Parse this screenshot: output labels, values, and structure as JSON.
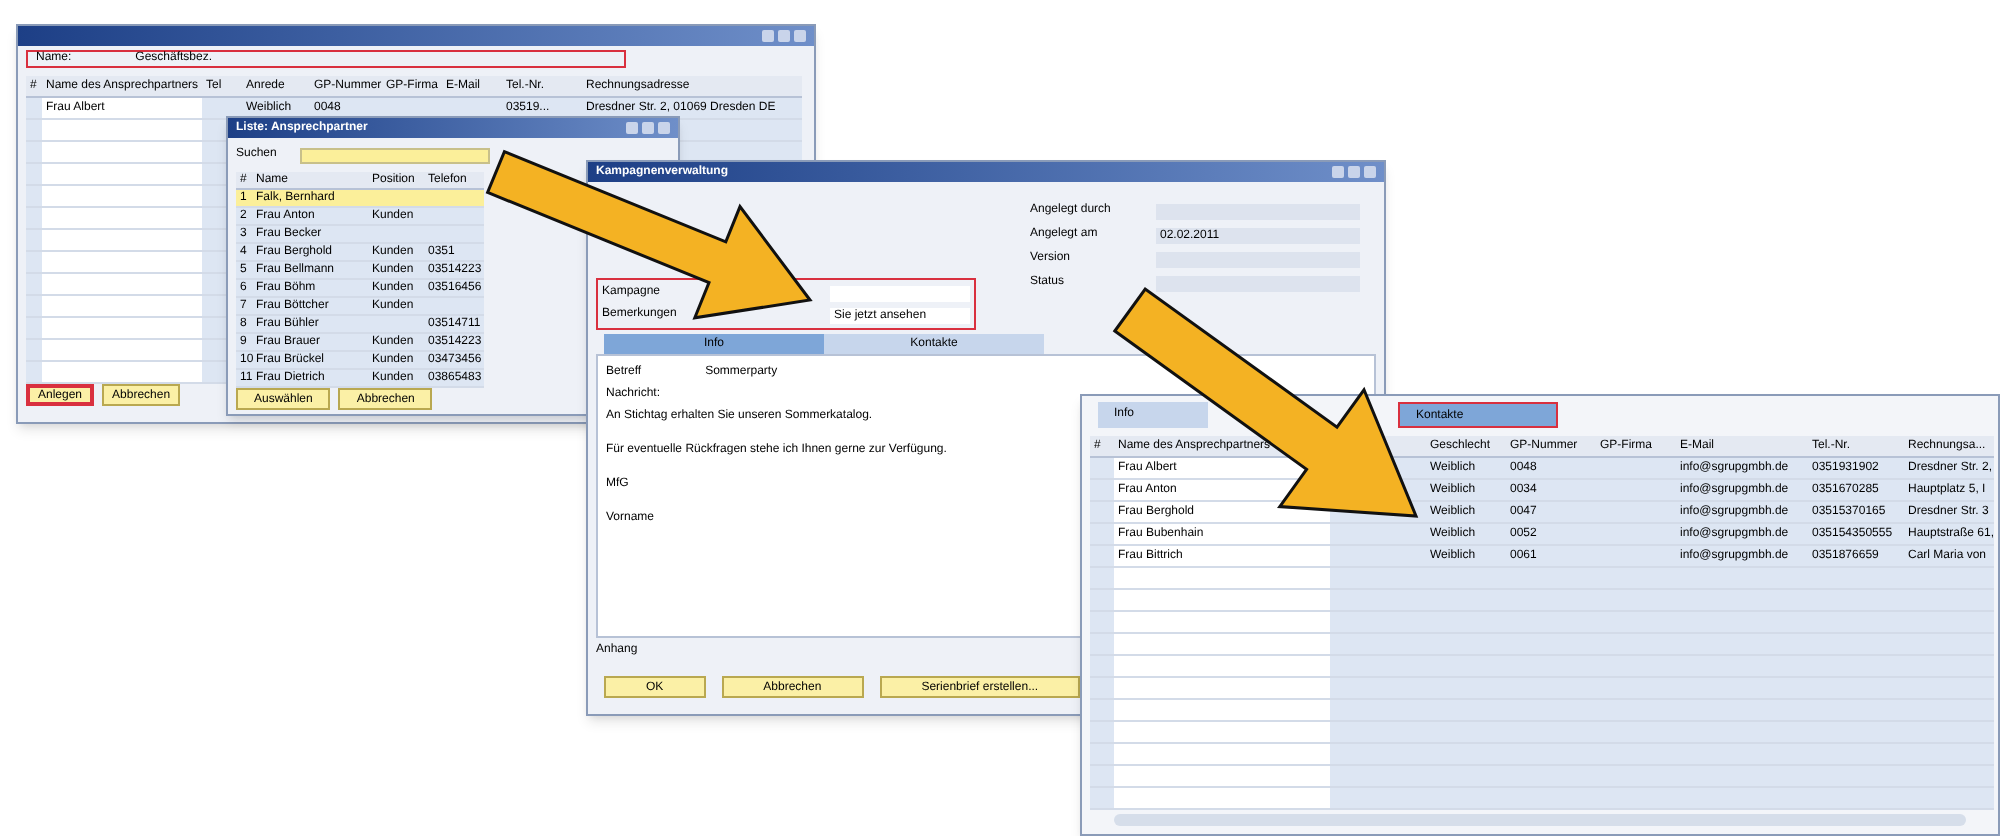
{
  "contact_window": {
    "name_label": "Name:",
    "name_value": "Geschäftsbez.",
    "columns": [
      "#",
      "Name des Ansprechpartners",
      "Tel",
      "Anrede",
      "GP-Nummer",
      "GP-Firma",
      "E-Mail",
      "Tel.-Nr.",
      "Rechnungsadresse"
    ],
    "rows": [
      {
        "cells": [
          "",
          "Frau Albert",
          "",
          "Weiblich",
          "0048",
          "",
          "",
          "03519...",
          "Dresdner Str. 2, 01069 Dresden DE"
        ]
      }
    ],
    "buttons": [
      {
        "label": "Anlegen",
        "highlighted": true
      },
      {
        "label": "Abbrechen",
        "highlighted": false
      }
    ]
  },
  "picker_window": {
    "title": "Liste: Ansprechpartner",
    "search_label": "Suchen",
    "columns": [
      "#",
      "Name",
      "Position",
      "Telefon"
    ],
    "rows": [
      {
        "cells": [
          "1",
          "Falk, Bernhard",
          "",
          ""
        ],
        "selected": true
      },
      {
        "cells": [
          "2",
          "Frau Anton",
          "Kunden",
          ""
        ],
        "selected": false
      },
      {
        "cells": [
          "3",
          "Frau Becker",
          "",
          ""
        ],
        "selected": false
      },
      {
        "cells": [
          "4",
          "Frau Berghold",
          "Kunden",
          "0351"
        ],
        "selected": false
      },
      {
        "cells": [
          "5",
          "Frau Bellmann",
          "Kunden",
          "03514223"
        ],
        "selected": false
      },
      {
        "cells": [
          "6",
          "Frau Böhm",
          "Kunden",
          "03516456"
        ],
        "selected": false
      },
      {
        "cells": [
          "7",
          "Frau Böttcher",
          "Kunden",
          ""
        ],
        "selected": false
      },
      {
        "cells": [
          "8",
          "Frau Bühler",
          "",
          "03514711"
        ],
        "selected": false
      },
      {
        "cells": [
          "9",
          "Frau Brauer",
          "Kunden",
          "03514223"
        ],
        "selected": false
      },
      {
        "cells": [
          "10",
          "Frau Brückel",
          "Kunden",
          "03473456"
        ],
        "selected": false
      },
      {
        "cells": [
          "11",
          "Frau Dietrich",
          "Kunden",
          "03865483"
        ],
        "selected": false
      }
    ],
    "buttons": [
      "Auswählen",
      "Abbrechen"
    ]
  },
  "campaign_window": {
    "title": "Kampagnenverwaltung",
    "left_fields": [
      {
        "label": "Kampagne"
      },
      {
        "label": "Bemerkungen",
        "value": "Sie jetzt ansehen"
      }
    ],
    "right_fields": [
      {
        "label": "Angelegt durch"
      },
      {
        "label": "Angelegt am",
        "value": "02.02.2011"
      },
      {
        "label": "Version"
      },
      {
        "label": "Status"
      }
    ],
    "tabs": [
      {
        "label": "Info",
        "selected": true
      },
      {
        "label": "Kontakte",
        "selected": false
      }
    ],
    "subject_label": "Betreff",
    "subject_value": "Sommerparty",
    "message_label": "Nachricht:",
    "message_lines": [
      "An Stichtag erhalten Sie unseren Sommerkatalog.",
      "Für eventuelle Rückfragen stehe ich Ihnen gerne zur Verfügung.",
      "MfG",
      "Vorname"
    ],
    "attachment_label": "Anhang",
    "buttons": [
      "OK",
      "Abbrechen",
      "Serienbrief erstellen..."
    ]
  },
  "contacts_window": {
    "tabs": [
      {
        "label": "Info",
        "selected": false
      },
      {
        "label": "Kontakte",
        "selected": true
      }
    ],
    "columns": [
      "#",
      "Name des Ansprechpartners",
      "",
      "Geschlecht",
      "GP-Nummer",
      "GP-Firma",
      "E-Mail",
      "Tel.-Nr.",
      "Rechnungsa..."
    ],
    "rows": [
      {
        "cells": [
          "",
          "Frau Albert",
          "",
          "Weiblich",
          "0048",
          "",
          "info@sgrupgmbh.de",
          "0351931902",
          "Dresdner Str. 2,"
        ]
      },
      {
        "cells": [
          "",
          "Frau Anton",
          "",
          "Weiblich",
          "0034",
          "",
          "info@sgrupgmbh.de",
          "0351670285",
          "Hauptplatz 5, I"
        ]
      },
      {
        "cells": [
          "",
          "Frau Berghold",
          "",
          "Weiblich",
          "0047",
          "",
          "info@sgrupgmbh.de",
          "03515370165",
          "Dresdner Str. 3"
        ]
      },
      {
        "cells": [
          "",
          "Frau Bubenhain",
          "",
          "Weiblich",
          "0052",
          "",
          "info@sgrupgmbh.de",
          "035154350555",
          "Hauptstraße 61,"
        ]
      },
      {
        "cells": [
          "",
          "Frau Bittrich",
          "",
          "Weiblich",
          "0061",
          "",
          "info@sgrupgmbh.de",
          "0351876659",
          "Carl Maria von"
        ]
      }
    ]
  }
}
